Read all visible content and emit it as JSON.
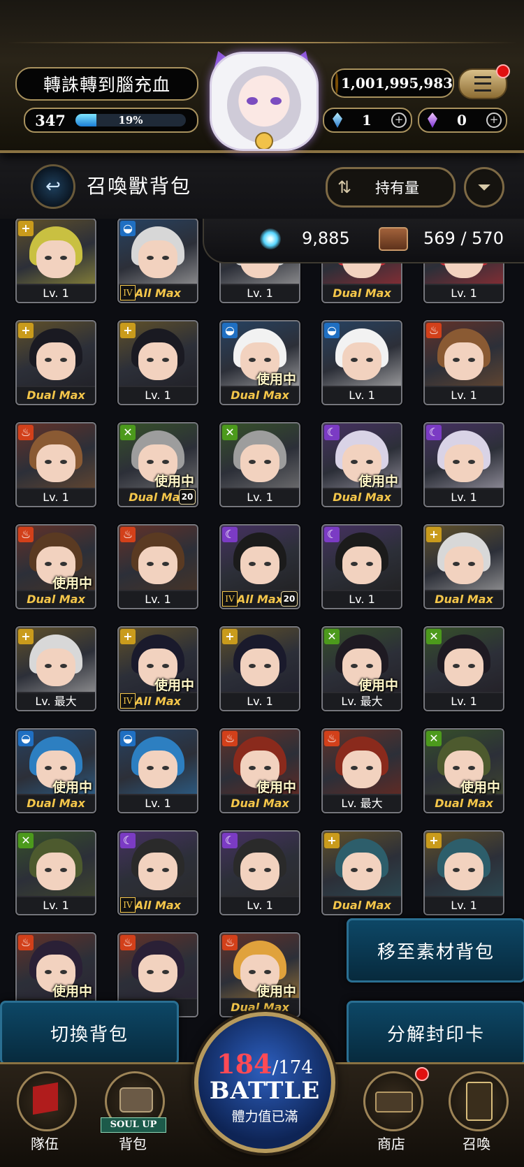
{
  "header": {
    "player_name": "轉誅轉到腦充血",
    "level": "347",
    "exp_percent": "19%",
    "exp_fraction": 0.19,
    "gold": "1,001,995,983",
    "crystal_blue": "1",
    "crystal_purple": "0",
    "plus": "+",
    "icons": {
      "menu": "menu-icon",
      "coin": "gold-coin-icon",
      "avatar": "player-avatar"
    }
  },
  "titlebar": {
    "title": "召喚獸背包",
    "sort_label": "持有量",
    "back_icon": "↩",
    "sort_icon": "⇅",
    "filter_icon": "⏷"
  },
  "stats": {
    "souls": "9,885",
    "capacity": "569 / 570"
  },
  "cards": [
    {
      "attr": "light",
      "label": "Lv. 1",
      "max": false,
      "in_use": false,
      "hair": "#c9c041",
      "rank": "",
      "badge": ""
    },
    {
      "attr": "water",
      "label": "All Max",
      "max": true,
      "in_use": false,
      "hair": "#d7d7d7",
      "rank": "IV",
      "badge": ""
    },
    {
      "attr": "light",
      "label": "Lv. 1",
      "max": false,
      "in_use": false,
      "hair": "#d7d7d7",
      "rank": "",
      "badge": ""
    },
    {
      "attr": "fire",
      "label": "Dual Max",
      "max": true,
      "in_use": false,
      "hair": "#c92f38",
      "rank": "",
      "badge": ""
    },
    {
      "attr": "fire",
      "label": "Lv. 1",
      "max": false,
      "in_use": false,
      "hair": "#c92f38",
      "rank": "",
      "badge": ""
    },
    {
      "attr": "light",
      "label": "Dual Max",
      "max": true,
      "in_use": false,
      "hair": "#1a1a22",
      "rank": "",
      "badge": ""
    },
    {
      "attr": "light",
      "label": "Lv. 1",
      "max": false,
      "in_use": false,
      "hair": "#1a1a22",
      "rank": "",
      "badge": ""
    },
    {
      "attr": "water",
      "label": "Dual Max",
      "max": true,
      "in_use": true,
      "hair": "#f2f2f2",
      "rank": "",
      "badge": ""
    },
    {
      "attr": "water",
      "label": "Lv. 1",
      "max": false,
      "in_use": false,
      "hair": "#f2f2f2",
      "rank": "",
      "badge": ""
    },
    {
      "attr": "fire",
      "label": "Lv. 1",
      "max": false,
      "in_use": false,
      "hair": "#8a5a33",
      "rank": "",
      "badge": ""
    },
    {
      "attr": "fire",
      "label": "Lv. 1",
      "max": false,
      "in_use": false,
      "hair": "#8a5a33",
      "rank": "",
      "badge": ""
    },
    {
      "attr": "wood",
      "label": "Dual Max",
      "max": true,
      "in_use": true,
      "hair": "#9d9d9d",
      "rank": "",
      "badge": "20"
    },
    {
      "attr": "wood",
      "label": "Lv. 1",
      "max": false,
      "in_use": false,
      "hair": "#9d9d9d",
      "rank": "",
      "badge": ""
    },
    {
      "attr": "dark",
      "label": "Dual Max",
      "max": true,
      "in_use": true,
      "hair": "#d9d3e6",
      "rank": "",
      "badge": ""
    },
    {
      "attr": "dark",
      "label": "Lv. 1",
      "max": false,
      "in_use": false,
      "hair": "#d9d3e6",
      "rank": "",
      "badge": ""
    },
    {
      "attr": "fire",
      "label": "Dual Max",
      "max": true,
      "in_use": true,
      "hair": "#5a3a22",
      "rank": "",
      "badge": ""
    },
    {
      "attr": "fire",
      "label": "Lv. 1",
      "max": false,
      "in_use": false,
      "hair": "#5a3a22",
      "rank": "",
      "badge": ""
    },
    {
      "attr": "dark",
      "label": "All Max",
      "max": true,
      "in_use": false,
      "hair": "#1b1b1b",
      "rank": "IV",
      "badge": "20"
    },
    {
      "attr": "dark",
      "label": "Lv. 1",
      "max": false,
      "in_use": false,
      "hair": "#1b1b1b",
      "rank": "",
      "badge": ""
    },
    {
      "attr": "light",
      "label": "Dual Max",
      "max": true,
      "in_use": false,
      "hair": "#d8d8d8",
      "rank": "",
      "badge": ""
    },
    {
      "attr": "light",
      "label": "Lv. 最大",
      "max": false,
      "in_use": false,
      "hair": "#d8d8d8",
      "rank": "",
      "badge": ""
    },
    {
      "attr": "light",
      "label": "All Max",
      "max": true,
      "in_use": true,
      "hair": "#1a1a2c",
      "rank": "IV",
      "badge": ""
    },
    {
      "attr": "light",
      "label": "Lv. 1",
      "max": false,
      "in_use": false,
      "hair": "#1a1a2c",
      "rank": "",
      "badge": ""
    },
    {
      "attr": "wood",
      "label": "Lv. 最大",
      "max": false,
      "in_use": true,
      "hair": "#1e1a22",
      "rank": "",
      "badge": ""
    },
    {
      "attr": "wood",
      "label": "Lv. 1",
      "max": false,
      "in_use": false,
      "hair": "#1e1a22",
      "rank": "",
      "badge": ""
    },
    {
      "attr": "water",
      "label": "Dual Max",
      "max": true,
      "in_use": true,
      "hair": "#2d7fc1",
      "rank": "",
      "badge": ""
    },
    {
      "attr": "water",
      "label": "Lv. 1",
      "max": false,
      "in_use": false,
      "hair": "#2d7fc1",
      "rank": "",
      "badge": ""
    },
    {
      "attr": "fire",
      "label": "Dual Max",
      "max": true,
      "in_use": true,
      "hair": "#8a2a1c",
      "rank": "",
      "badge": ""
    },
    {
      "attr": "fire",
      "label": "Lv. 最大",
      "max": false,
      "in_use": false,
      "hair": "#8a2a1c",
      "rank": "",
      "badge": ""
    },
    {
      "attr": "wood",
      "label": "Dual Max",
      "max": true,
      "in_use": true,
      "hair": "#4d5a2e",
      "rank": "",
      "badge": ""
    },
    {
      "attr": "wood",
      "label": "Lv. 1",
      "max": false,
      "in_use": false,
      "hair": "#4d5a2e",
      "rank": "",
      "badge": ""
    },
    {
      "attr": "dark",
      "label": "All Max",
      "max": true,
      "in_use": false,
      "hair": "#2a2a2a",
      "rank": "IV",
      "badge": ""
    },
    {
      "attr": "dark",
      "label": "Lv. 1",
      "max": false,
      "in_use": false,
      "hair": "#2a2a2a",
      "rank": "",
      "badge": ""
    },
    {
      "attr": "light",
      "label": "Dual Max",
      "max": true,
      "in_use": false,
      "hair": "#2d5e6b",
      "rank": "",
      "badge": ""
    },
    {
      "attr": "light",
      "label": "Lv. 1",
      "max": false,
      "in_use": false,
      "hair": "#2d5e6b",
      "rank": "",
      "badge": ""
    },
    {
      "attr": "fire",
      "label": "",
      "max": false,
      "in_use": true,
      "hair": "#2a2036",
      "rank": "",
      "badge": ""
    },
    {
      "attr": "fire",
      "label": "",
      "max": false,
      "in_use": false,
      "hair": "#2a2036",
      "rank": "",
      "badge": ""
    },
    {
      "attr": "fire",
      "label": "Dual Max",
      "max": true,
      "in_use": true,
      "hair": "#e0a23c",
      "rank": "",
      "badge": ""
    }
  ],
  "in_use_text": "使用中",
  "attr_colors": {
    "light": "#c99b1c",
    "water": "#1f6fc2",
    "fire": "#d2401a",
    "wood": "#4c9a1c",
    "dark": "#7b3bc4"
  },
  "attr_glyphs": {
    "light": "+",
    "water": "◒",
    "fire": "♨",
    "wood": "✕",
    "dark": "☾"
  },
  "actions": {
    "move_to_material": "移至素材背包",
    "switch_bag": "切換背包",
    "decompose": "分解封印卡"
  },
  "battle": {
    "stamina_current": "184",
    "stamina_max": "/174",
    "label": "BATTLE",
    "sub": "體力值已滿"
  },
  "nav": {
    "team": "隊伍",
    "bag": "背包",
    "soul_up": "SOUL UP",
    "shop": "商店",
    "summon": "召喚"
  }
}
